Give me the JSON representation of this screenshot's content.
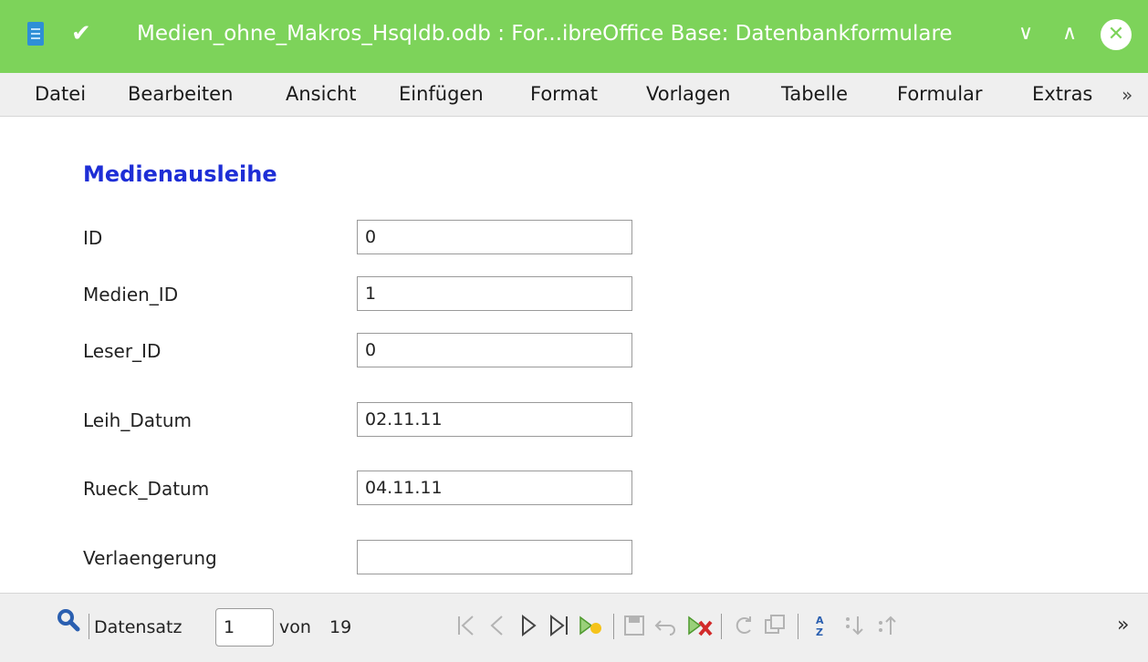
{
  "window": {
    "title": "Medien_ohne_Makros_Hsqldb.odb : For...ibreOffice Base: Datenbankformulare",
    "minimize_glyph": "∨",
    "maximize_glyph": "∧",
    "close_glyph": "✕",
    "pin_glyph": "✔",
    "titlebar_color": "#7dd35a"
  },
  "menubar": {
    "items": [
      "Datei",
      "Bearbeiten",
      "Ansicht",
      "Einfügen",
      "Format",
      "Vorlagen",
      "Tabelle",
      "Formular",
      "Extras"
    ],
    "more_label": "»"
  },
  "form": {
    "title": "Medienausleihe",
    "title_color": "#1e2ed6",
    "fields": [
      {
        "label": "ID",
        "value": "0"
      },
      {
        "label": "Medien_ID",
        "value": "1"
      },
      {
        "label": "Leser_ID",
        "value": "0"
      },
      {
        "label": "Leih_Datum",
        "value": "02.11.11"
      },
      {
        "label": "Rueck_Datum",
        "value": "04.11.11"
      },
      {
        "label": "Verlaengerung",
        "value": ""
      }
    ]
  },
  "navigation": {
    "record_label": "Datensatz",
    "current_record": "1",
    "of_label": "von",
    "total_records": "19",
    "more_label": "»",
    "icons": [
      "first-record-icon",
      "previous-record-icon",
      "next-record-icon",
      "last-record-icon",
      "new-record-icon",
      "save-record-icon",
      "undo-icon",
      "delete-record-icon",
      "refresh-icon",
      "refresh-control-icon",
      "sort-icon",
      "sort-ascending-icon",
      "sort-descending-icon"
    ]
  }
}
